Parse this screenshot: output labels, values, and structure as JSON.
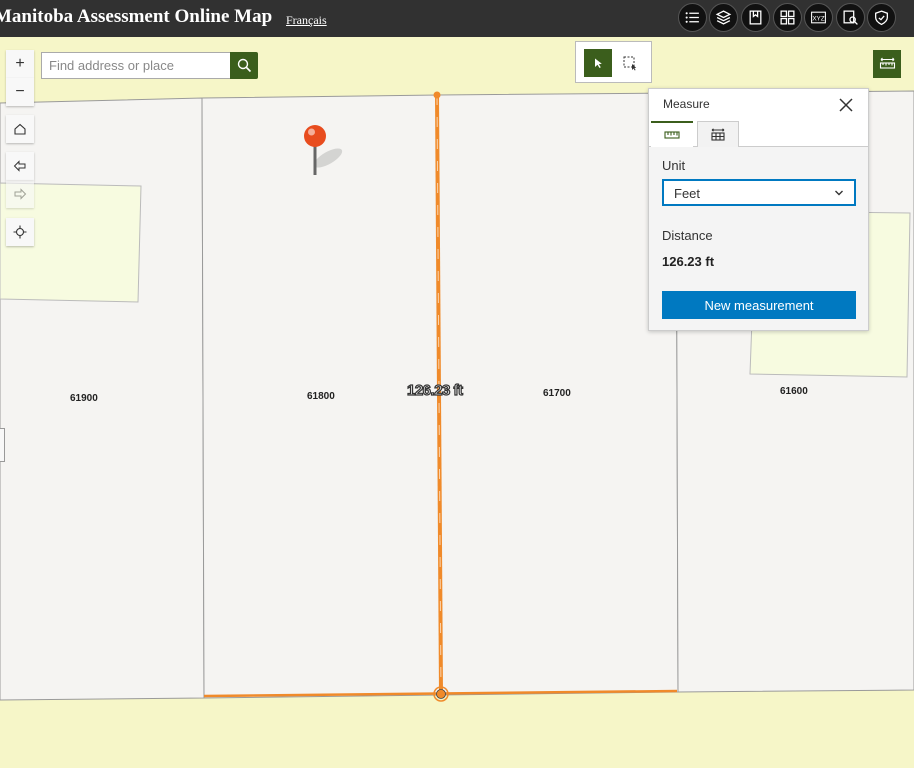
{
  "header": {
    "title": "Manitoba Assessment Online Map",
    "language_link": "Français",
    "toolbar_icons": [
      "list-icon",
      "layers-icon",
      "bookmark-icon",
      "basemap-gallery-icon",
      "coordinate-xyz-icon",
      "query-search-icon",
      "shield-badge-icon"
    ]
  },
  "search": {
    "placeholder": "Find address or place",
    "value": ""
  },
  "map_controls": {
    "zoom_in": "+",
    "zoom_out": "−",
    "icons": [
      "home-icon",
      "back-arrow-icon",
      "forward-arrow-icon",
      "locate-icon"
    ]
  },
  "parcels": {
    "labels": [
      "61900",
      "61800",
      "61700",
      "61600"
    ]
  },
  "measurement_label": "126.23 ft",
  "measure_panel": {
    "title": "Measure",
    "tabs": [
      "distance-ruler-icon",
      "area-icon"
    ],
    "unit_label": "Unit",
    "unit_value": "Feet",
    "distance_label": "Distance",
    "distance_value": "126.23 ft",
    "new_button": "New measurement"
  },
  "colors": {
    "header_bg": "#313131",
    "accent_green": "#3b5e1c",
    "button_blue": "#0079c1",
    "measure_line": "#f08a2a",
    "parcel_fill": "#f5f4f2",
    "background_yellow": "#f6f6c8"
  }
}
